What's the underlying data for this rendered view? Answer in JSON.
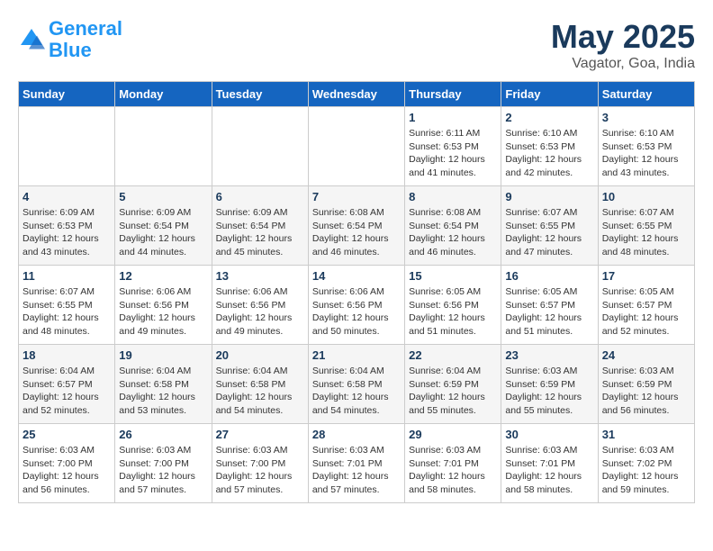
{
  "header": {
    "logo_line1": "General",
    "logo_line2": "Blue",
    "month": "May 2025",
    "location": "Vagator, Goa, India"
  },
  "weekdays": [
    "Sunday",
    "Monday",
    "Tuesday",
    "Wednesday",
    "Thursday",
    "Friday",
    "Saturday"
  ],
  "weeks": [
    [
      {
        "day": "",
        "info": ""
      },
      {
        "day": "",
        "info": ""
      },
      {
        "day": "",
        "info": ""
      },
      {
        "day": "",
        "info": ""
      },
      {
        "day": "1",
        "info": "Sunrise: 6:11 AM\nSunset: 6:53 PM\nDaylight: 12 hours\nand 41 minutes."
      },
      {
        "day": "2",
        "info": "Sunrise: 6:10 AM\nSunset: 6:53 PM\nDaylight: 12 hours\nand 42 minutes."
      },
      {
        "day": "3",
        "info": "Sunrise: 6:10 AM\nSunset: 6:53 PM\nDaylight: 12 hours\nand 43 minutes."
      }
    ],
    [
      {
        "day": "4",
        "info": "Sunrise: 6:09 AM\nSunset: 6:53 PM\nDaylight: 12 hours\nand 43 minutes."
      },
      {
        "day": "5",
        "info": "Sunrise: 6:09 AM\nSunset: 6:54 PM\nDaylight: 12 hours\nand 44 minutes."
      },
      {
        "day": "6",
        "info": "Sunrise: 6:09 AM\nSunset: 6:54 PM\nDaylight: 12 hours\nand 45 minutes."
      },
      {
        "day": "7",
        "info": "Sunrise: 6:08 AM\nSunset: 6:54 PM\nDaylight: 12 hours\nand 46 minutes."
      },
      {
        "day": "8",
        "info": "Sunrise: 6:08 AM\nSunset: 6:54 PM\nDaylight: 12 hours\nand 46 minutes."
      },
      {
        "day": "9",
        "info": "Sunrise: 6:07 AM\nSunset: 6:55 PM\nDaylight: 12 hours\nand 47 minutes."
      },
      {
        "day": "10",
        "info": "Sunrise: 6:07 AM\nSunset: 6:55 PM\nDaylight: 12 hours\nand 48 minutes."
      }
    ],
    [
      {
        "day": "11",
        "info": "Sunrise: 6:07 AM\nSunset: 6:55 PM\nDaylight: 12 hours\nand 48 minutes."
      },
      {
        "day": "12",
        "info": "Sunrise: 6:06 AM\nSunset: 6:56 PM\nDaylight: 12 hours\nand 49 minutes."
      },
      {
        "day": "13",
        "info": "Sunrise: 6:06 AM\nSunset: 6:56 PM\nDaylight: 12 hours\nand 49 minutes."
      },
      {
        "day": "14",
        "info": "Sunrise: 6:06 AM\nSunset: 6:56 PM\nDaylight: 12 hours\nand 50 minutes."
      },
      {
        "day": "15",
        "info": "Sunrise: 6:05 AM\nSunset: 6:56 PM\nDaylight: 12 hours\nand 51 minutes."
      },
      {
        "day": "16",
        "info": "Sunrise: 6:05 AM\nSunset: 6:57 PM\nDaylight: 12 hours\nand 51 minutes."
      },
      {
        "day": "17",
        "info": "Sunrise: 6:05 AM\nSunset: 6:57 PM\nDaylight: 12 hours\nand 52 minutes."
      }
    ],
    [
      {
        "day": "18",
        "info": "Sunrise: 6:04 AM\nSunset: 6:57 PM\nDaylight: 12 hours\nand 52 minutes."
      },
      {
        "day": "19",
        "info": "Sunrise: 6:04 AM\nSunset: 6:58 PM\nDaylight: 12 hours\nand 53 minutes."
      },
      {
        "day": "20",
        "info": "Sunrise: 6:04 AM\nSunset: 6:58 PM\nDaylight: 12 hours\nand 54 minutes."
      },
      {
        "day": "21",
        "info": "Sunrise: 6:04 AM\nSunset: 6:58 PM\nDaylight: 12 hours\nand 54 minutes."
      },
      {
        "day": "22",
        "info": "Sunrise: 6:04 AM\nSunset: 6:59 PM\nDaylight: 12 hours\nand 55 minutes."
      },
      {
        "day": "23",
        "info": "Sunrise: 6:03 AM\nSunset: 6:59 PM\nDaylight: 12 hours\nand 55 minutes."
      },
      {
        "day": "24",
        "info": "Sunrise: 6:03 AM\nSunset: 6:59 PM\nDaylight: 12 hours\nand 56 minutes."
      }
    ],
    [
      {
        "day": "25",
        "info": "Sunrise: 6:03 AM\nSunset: 7:00 PM\nDaylight: 12 hours\nand 56 minutes."
      },
      {
        "day": "26",
        "info": "Sunrise: 6:03 AM\nSunset: 7:00 PM\nDaylight: 12 hours\nand 57 minutes."
      },
      {
        "day": "27",
        "info": "Sunrise: 6:03 AM\nSunset: 7:00 PM\nDaylight: 12 hours\nand 57 minutes."
      },
      {
        "day": "28",
        "info": "Sunrise: 6:03 AM\nSunset: 7:01 PM\nDaylight: 12 hours\nand 57 minutes."
      },
      {
        "day": "29",
        "info": "Sunrise: 6:03 AM\nSunset: 7:01 PM\nDaylight: 12 hours\nand 58 minutes."
      },
      {
        "day": "30",
        "info": "Sunrise: 6:03 AM\nSunset: 7:01 PM\nDaylight: 12 hours\nand 58 minutes."
      },
      {
        "day": "31",
        "info": "Sunrise: 6:03 AM\nSunset: 7:02 PM\nDaylight: 12 hours\nand 59 minutes."
      }
    ]
  ]
}
